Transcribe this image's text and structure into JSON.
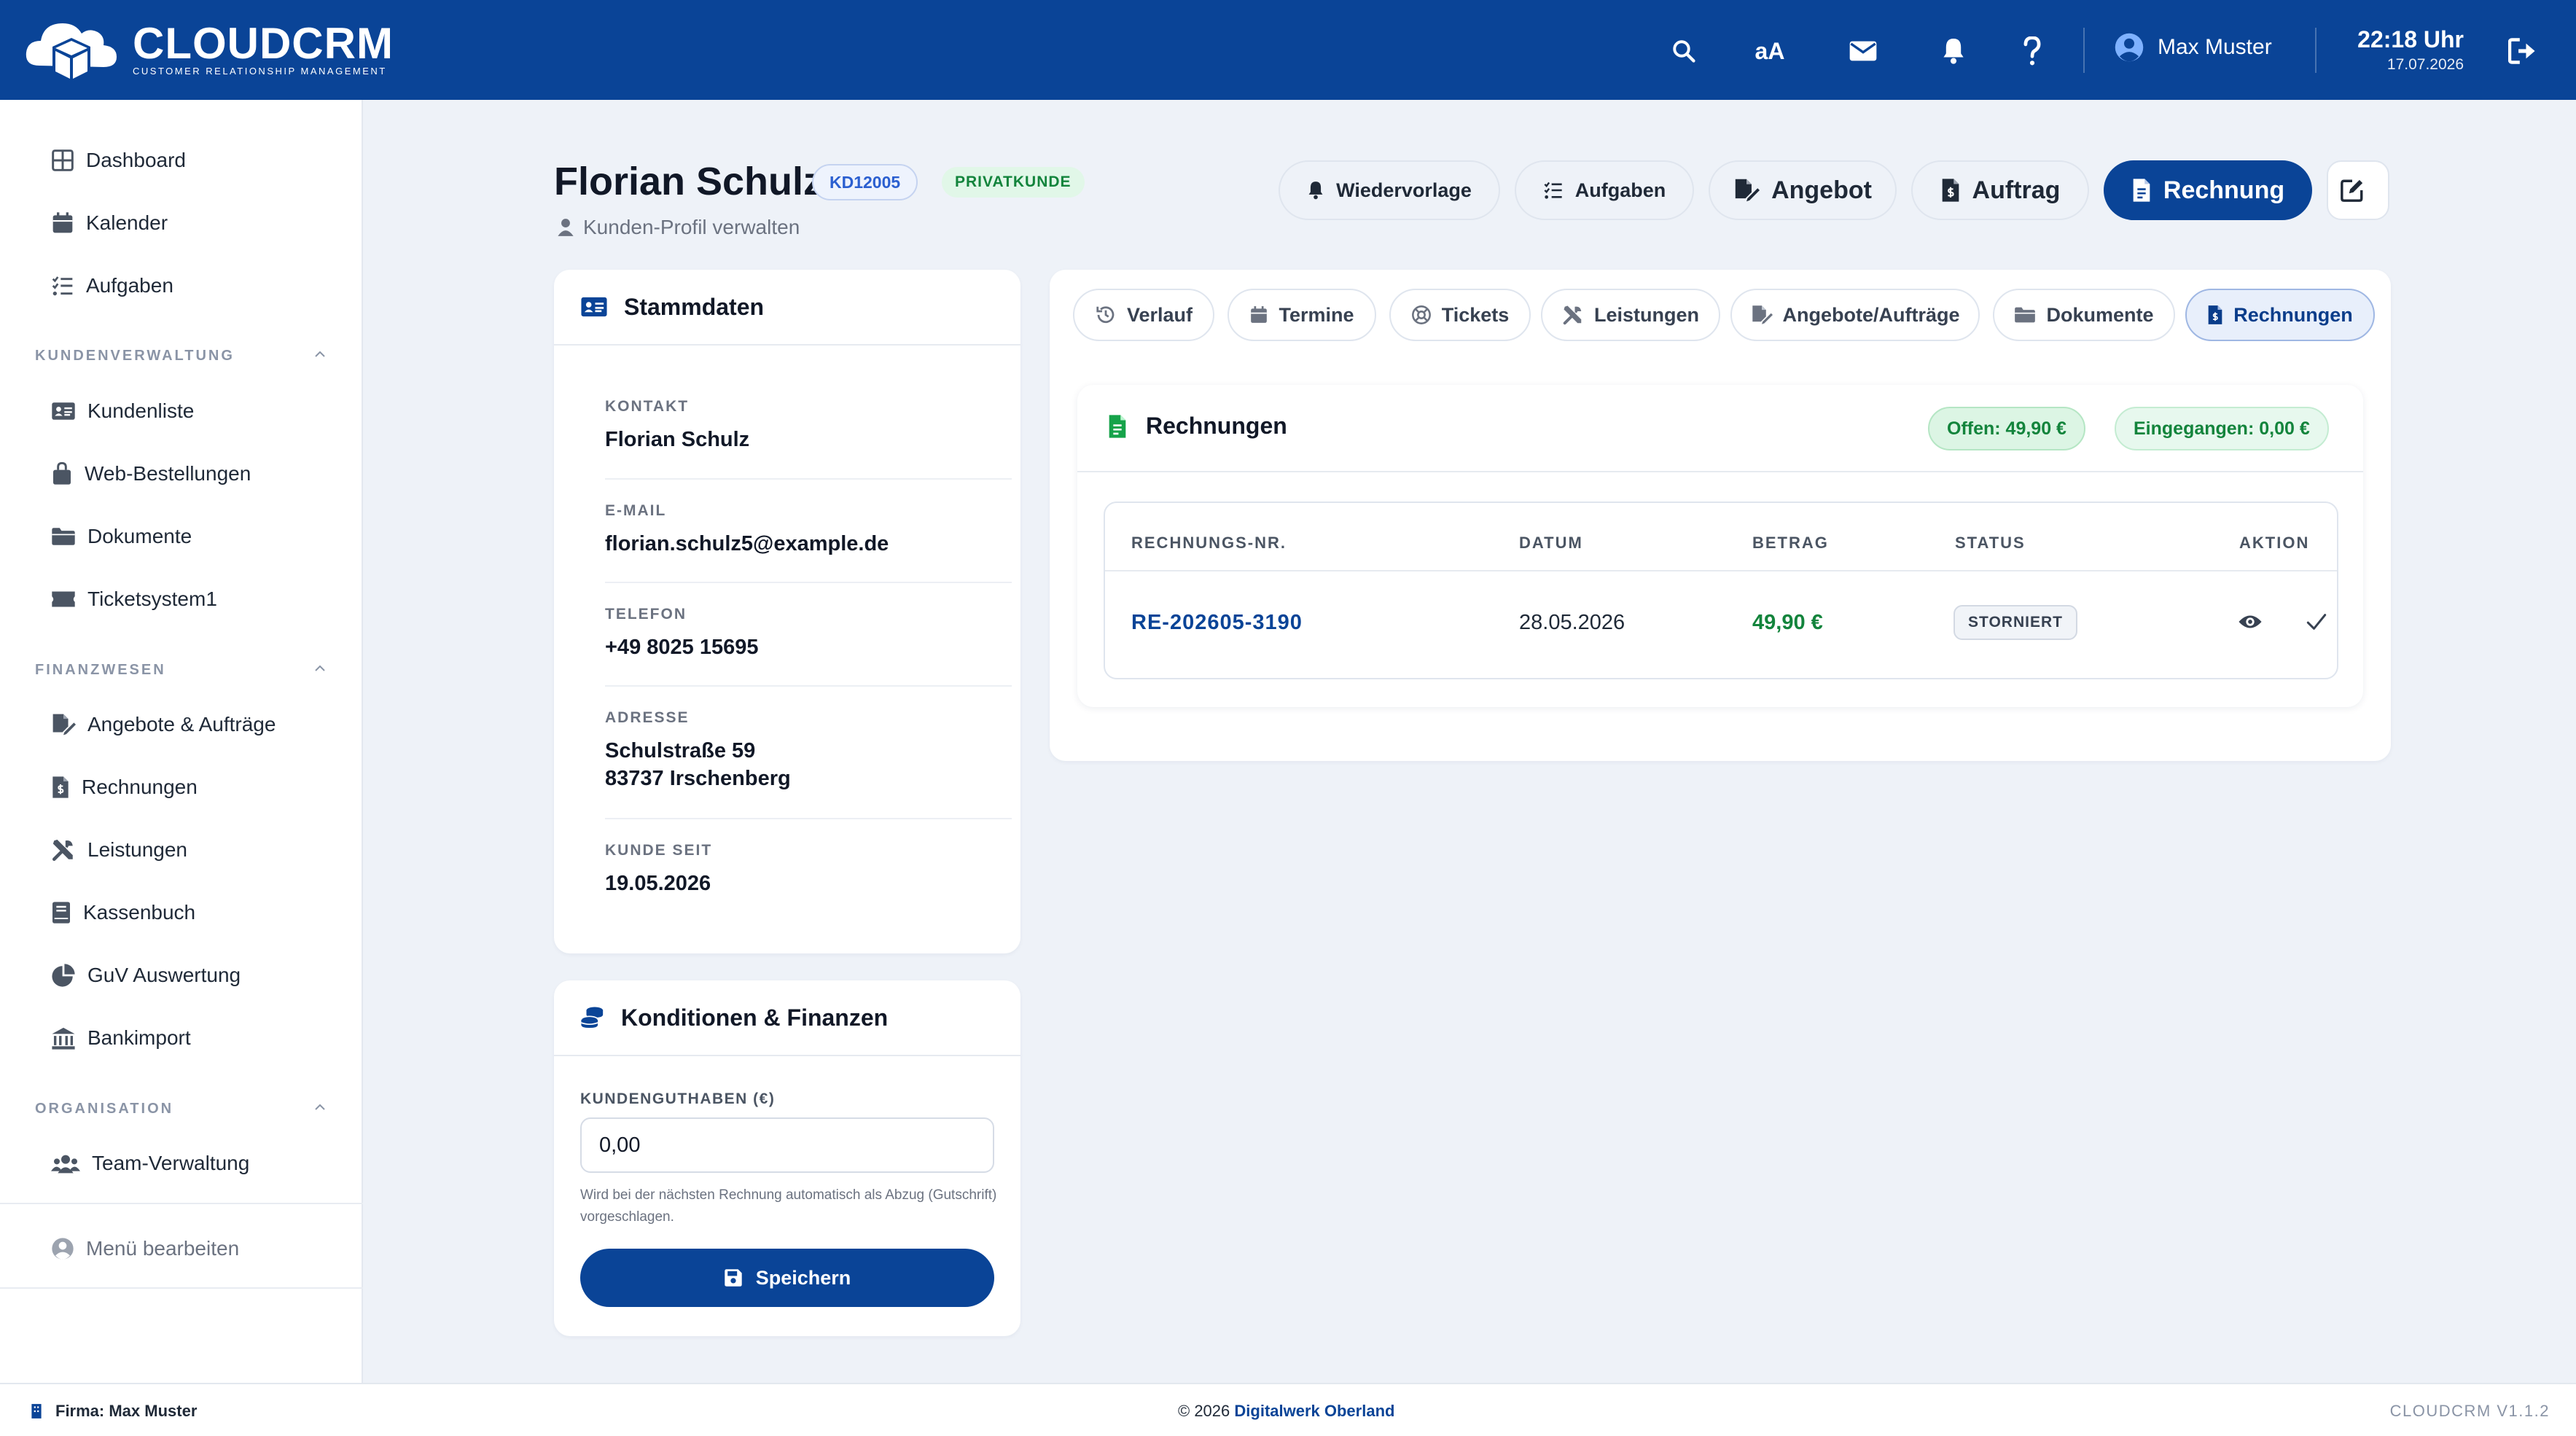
{
  "app": {
    "name": "CLOUDCRM",
    "tagline": "CUSTOMER RELATIONSHIP MANAGEMENT"
  },
  "topbar": {
    "font_toggle_label": "aA",
    "user_name": "Max Muster",
    "time": "22:18 Uhr",
    "date": "17.07.2026"
  },
  "sidebar": {
    "top_items": [
      {
        "label": "Dashboard",
        "icon": "grid-icon"
      },
      {
        "label": "Kalender",
        "icon": "calendar-icon"
      },
      {
        "label": "Aufgaben",
        "icon": "tasks-icon"
      }
    ],
    "sections": [
      {
        "title": "KUNDENVERWALTUNG",
        "items": [
          {
            "label": "Kundenliste",
            "icon": "address-card-icon"
          },
          {
            "label": "Web-Bestellungen",
            "icon": "shopping-bag-icon"
          },
          {
            "label": "Dokumente",
            "icon": "folder-icon"
          },
          {
            "label": "Ticketsystem1",
            "icon": "ticket-icon"
          }
        ]
      },
      {
        "title": "FINANZWESEN",
        "items": [
          {
            "label": "Angebote & Aufträge",
            "icon": "file-signature-icon"
          },
          {
            "label": "Rechnungen",
            "icon": "invoice-icon"
          },
          {
            "label": "Leistungen",
            "icon": "tools-icon"
          },
          {
            "label": "Kassenbuch",
            "icon": "book-icon"
          },
          {
            "label": "GuV Auswertung",
            "icon": "pie-chart-icon"
          },
          {
            "label": "Bankimport",
            "icon": "bank-icon"
          }
        ]
      },
      {
        "title": "ORGANISATION",
        "items": [
          {
            "label": "Team-Verwaltung",
            "icon": "users-icon"
          }
        ]
      }
    ],
    "edit_menu": "Menü bearbeiten"
  },
  "customer": {
    "name": "Florian Schulz",
    "id": "KD12005",
    "type": "PRIVATKUNDE",
    "subtitle": "Kunden-Profil verwalten"
  },
  "header_actions": {
    "wiedervorlage": "Wiedervorlage",
    "aufgaben": "Aufgaben",
    "angebot": "Angebot",
    "auftrag": "Auftrag",
    "rechnung": "Rechnung"
  },
  "stammdaten": {
    "title": "Stammdaten",
    "fields": [
      {
        "label": "KONTAKT",
        "value": "Florian Schulz"
      },
      {
        "label": "E-MAIL",
        "value": "florian.schulz5@example.de"
      },
      {
        "label": "TELEFON",
        "value": "+49 8025 15695"
      },
      {
        "label": "ADRESSE",
        "value": "Schulstraße 59",
        "value2": "83737 Irschenberg"
      },
      {
        "label": "KUNDE SEIT",
        "value": "19.05.2026"
      }
    ]
  },
  "konditionen": {
    "title": "Konditionen & Finanzen",
    "credit_label": "KUNDENGUTHABEN (€)",
    "credit_value": "0,00",
    "help_text": "Wird bei der nächsten Rechnung automatisch als Abzug (Gutschrift) vorgeschlagen.",
    "save_label": "Speichern"
  },
  "tabs": [
    {
      "label": "Verlauf",
      "icon": "history-icon"
    },
    {
      "label": "Termine",
      "icon": "calendar-icon"
    },
    {
      "label": "Tickets",
      "icon": "lifebuoy-icon"
    },
    {
      "label": "Leistungen",
      "icon": "tools-icon"
    },
    {
      "label": "Angebote/Aufträge",
      "icon": "file-signature-icon"
    },
    {
      "label": "Dokumente",
      "icon": "folder-icon"
    },
    {
      "label": "Rechnungen",
      "icon": "invoice-icon",
      "active": true
    }
  ],
  "invoices": {
    "title": "Rechnungen",
    "open": "Offen: 49,90 €",
    "received": "Eingegangen: 0,00 €",
    "columns": [
      "RECHNUNGS-NR.",
      "DATUM",
      "BETRAG",
      "STATUS",
      "AKTION"
    ],
    "rows": [
      {
        "number": "RE-202605-3190",
        "date": "28.05.2026",
        "amount": "49,90 €",
        "status": "STORNIERT"
      }
    ]
  },
  "footer": {
    "company": "Firma: Max Muster",
    "copyright": "© 2026 ",
    "vendor": "Digitalwerk Oberland",
    "version": "CLOUDCRM V1.1.2"
  },
  "colors": {
    "primary": "#0a4497",
    "success": "#13843c",
    "background": "#eef2f8"
  }
}
